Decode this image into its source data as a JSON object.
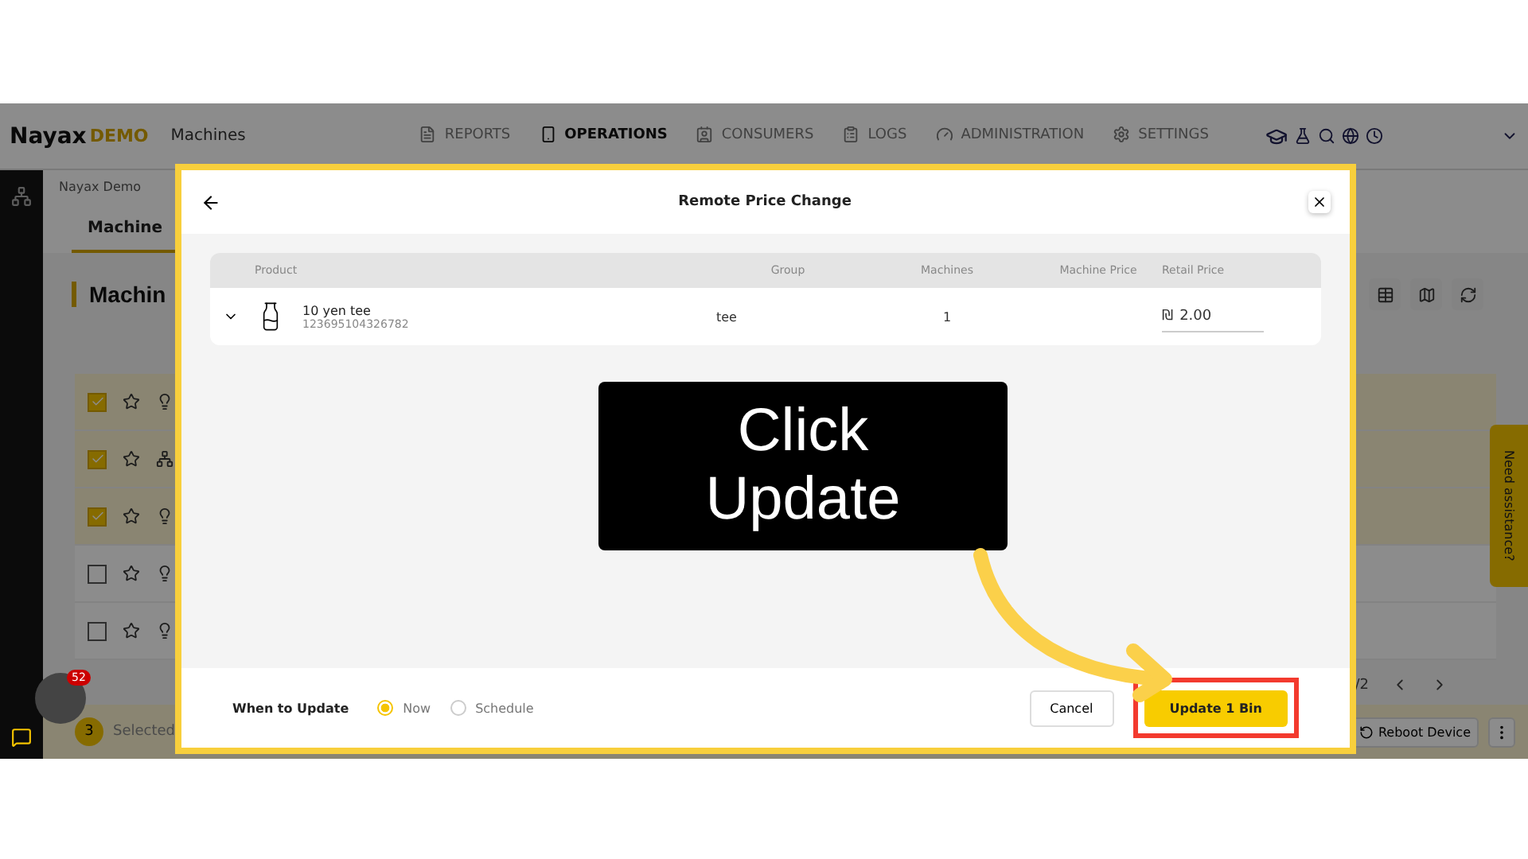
{
  "header": {
    "logo": "Nayax",
    "logo_suffix": "DEMO",
    "section": "Machines",
    "nav": [
      {
        "label": "REPORTS",
        "selected": false
      },
      {
        "label": "OPERATIONS",
        "selected": true
      },
      {
        "label": "CONSUMERS",
        "selected": false
      },
      {
        "label": "LOGS",
        "selected": false
      },
      {
        "label": "ADMINISTRATION",
        "selected": false
      },
      {
        "label": "SETTINGS",
        "selected": false
      }
    ]
  },
  "breadcrumb": "Nayax Demo",
  "tabs": [
    {
      "label": "Machine",
      "selected": true
    }
  ],
  "page_title": "Machin",
  "rows": [
    {
      "checked": true
    },
    {
      "checked": true
    },
    {
      "checked": true
    },
    {
      "checked": false
    },
    {
      "checked": false
    }
  ],
  "selection": {
    "count": "3",
    "label": "Selected"
  },
  "pager": "/2",
  "footer_button": "Reboot Device",
  "assistance": "Need assistance?",
  "notification_count": "52",
  "modal": {
    "title": "Remote Price Change",
    "columns": [
      "Product",
      "Group",
      "Machines",
      "Machine Price",
      "Retail Price"
    ],
    "rows": [
      {
        "product": "10 yen tee",
        "code": "123695104326782",
        "group": "tee",
        "machines": "1",
        "currency": "₪",
        "retail_price": "2.00"
      }
    ],
    "when_label": "When to Update",
    "options": [
      {
        "label": "Now",
        "selected": true
      },
      {
        "label": "Schedule",
        "selected": false
      }
    ],
    "cancel": "Cancel",
    "update": "Update 1 Bin"
  },
  "callout": "Click Update"
}
